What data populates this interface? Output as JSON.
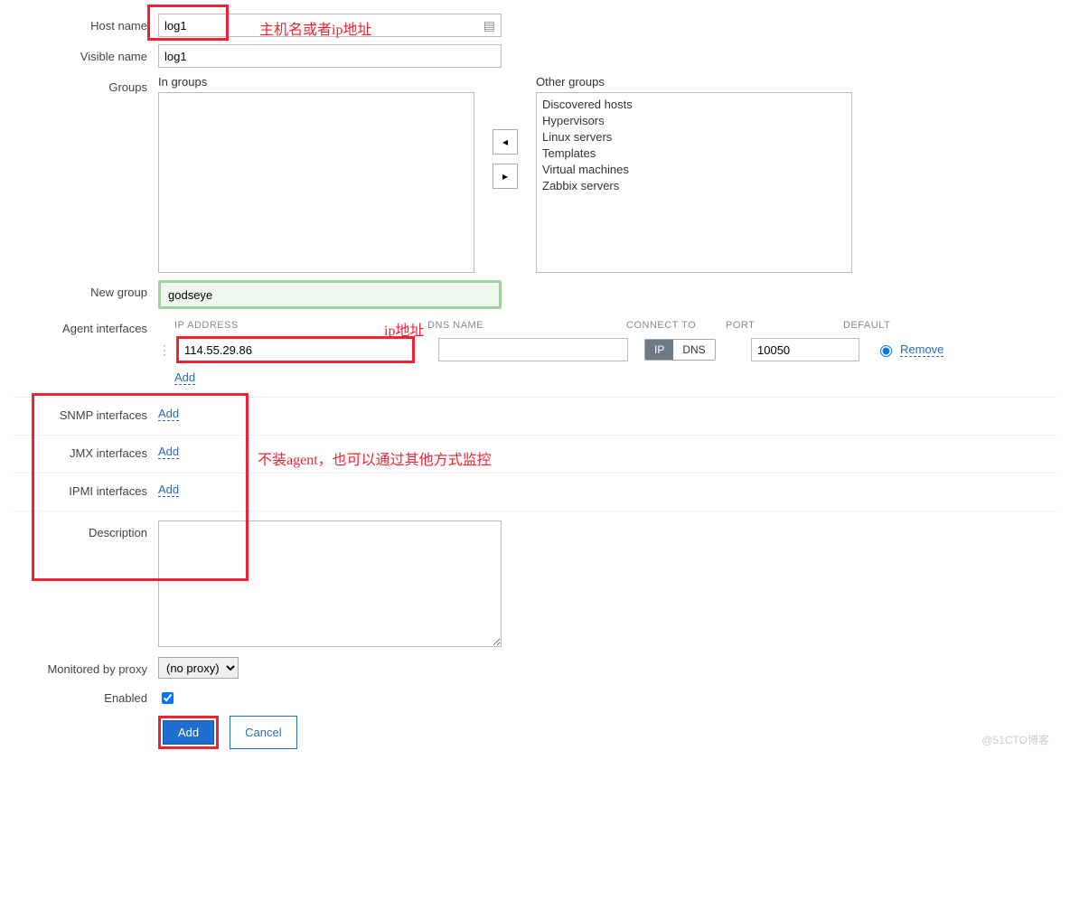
{
  "labels": {
    "host_name": "Host name",
    "visible_name": "Visible name",
    "groups": "Groups",
    "in_groups": "In groups",
    "other_groups": "Other groups",
    "new_group": "New group",
    "agent_interfaces": "Agent interfaces",
    "snmp_interfaces": "SNMP interfaces",
    "jmx_interfaces": "JMX interfaces",
    "ipmi_interfaces": "IPMI interfaces",
    "description": "Description",
    "monitored_by_proxy": "Monitored by proxy",
    "enabled": "Enabled"
  },
  "values": {
    "host_name": "log1",
    "visible_name": "log1",
    "new_group": "godseye",
    "agent_ip": "114.55.29.86",
    "agent_dns": "",
    "agent_port": "10050",
    "connect_to": "IP",
    "proxy": "(no proxy)",
    "enabled": true,
    "description": ""
  },
  "other_groups_list": [
    "Discovered hosts",
    "Hypervisors",
    "Linux servers",
    "Templates",
    "Virtual machines",
    "Zabbix servers"
  ],
  "iface_headers": {
    "ip": "IP ADDRESS",
    "dns": "DNS NAME",
    "connect": "CONNECT TO",
    "port": "PORT",
    "default": "DEFAULT"
  },
  "links": {
    "add": "Add",
    "remove": "Remove"
  },
  "connect_options": {
    "ip": "IP",
    "dns": "DNS"
  },
  "buttons": {
    "add": "Add",
    "cancel": "Cancel"
  },
  "annotations": {
    "hostname": "主机名或者ip地址",
    "ip": "ip地址",
    "interfaces": "不装agent，也可以通过其他方式监控"
  },
  "watermark": "@51CTO博客"
}
